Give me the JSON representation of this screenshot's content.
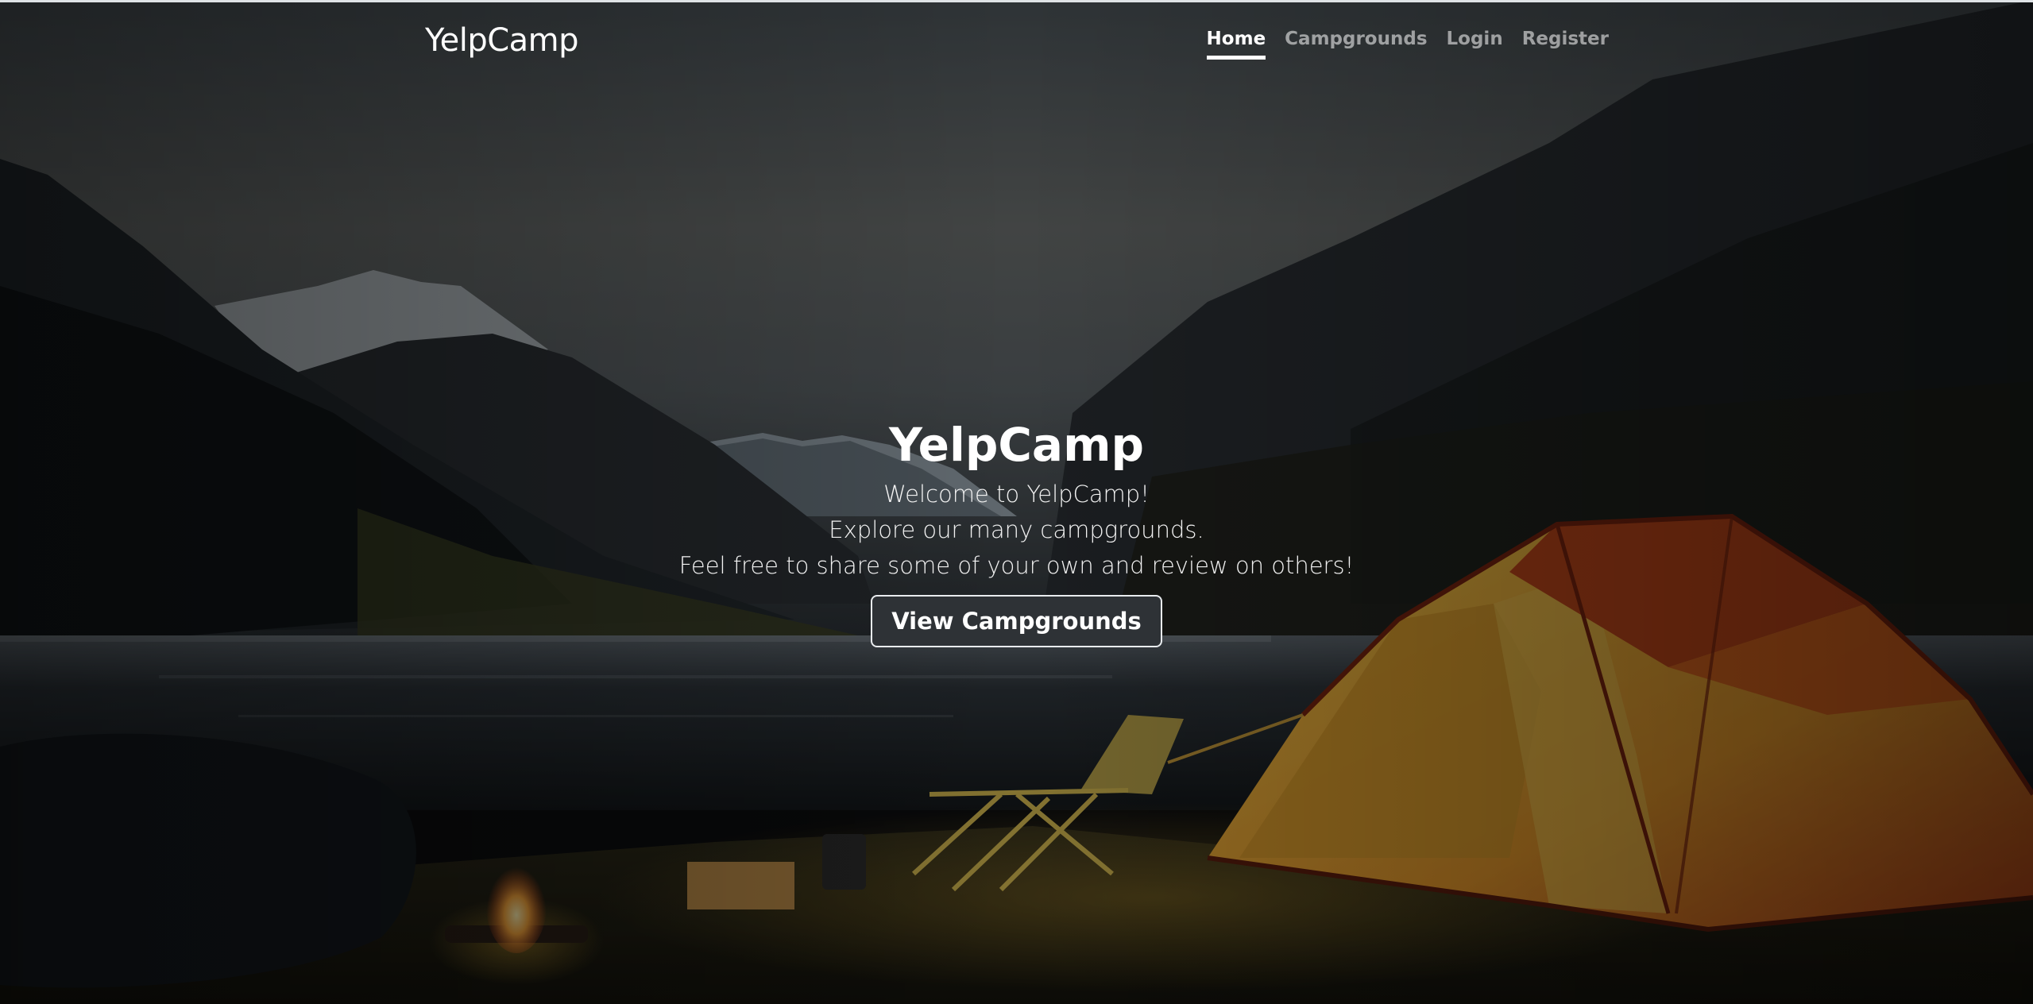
{
  "brand": "YelpCamp",
  "nav": {
    "links": [
      {
        "label": "Home",
        "active": true
      },
      {
        "label": "Campgrounds",
        "active": false
      },
      {
        "label": "Login",
        "active": false
      },
      {
        "label": "Register",
        "active": false
      }
    ]
  },
  "hero": {
    "title": "YelpCamp",
    "lines": [
      "Welcome to YelpCamp!",
      "Explore our many campgrounds.",
      "Feel free to share some of your own and review on others!"
    ],
    "cta_label": "View Campgrounds"
  },
  "icons": {
    "background": "campsite-scene-image",
    "tent": "tent-illustration",
    "campfire": "campfire-illustration",
    "chair": "camp-chair-illustration"
  },
  "colors": {
    "text_primary": "#ffffff",
    "text_muted": "#8c8f92",
    "button_bg": "#2e3236",
    "tent_orange": "#e06a1b",
    "tent_yellow": "#f2b437"
  }
}
